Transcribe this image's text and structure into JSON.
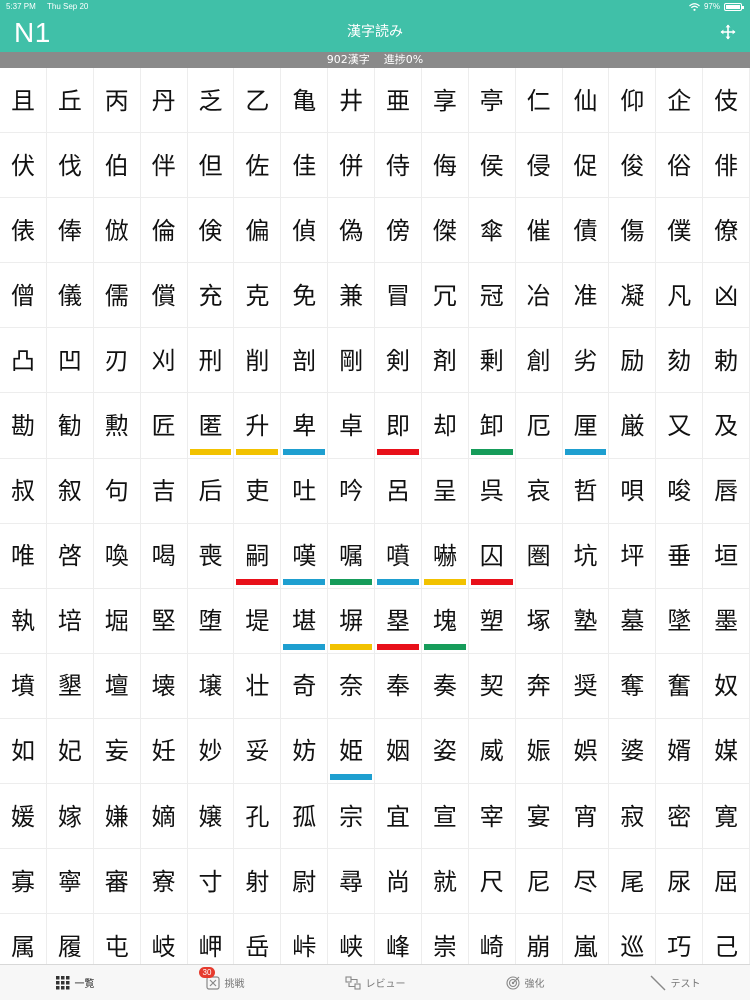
{
  "status_bar": {
    "time": "5:37 PM",
    "date": "Thu Sep 20",
    "battery": "97%",
    "battery_level": 0.97,
    "icons": [
      "wifi-icon",
      "battery-icon"
    ]
  },
  "header": {
    "level": "N1",
    "title": "漢字読み",
    "action_icon": "move-arrows-icon"
  },
  "progress": {
    "count_label": "902漢字",
    "progress_label": "進捗0%"
  },
  "colors": {
    "accent": "#40c0a8",
    "progress_bg": "#8a8a8a",
    "mark_yellow": "#f2c200",
    "mark_blue": "#1e9fd0",
    "mark_red": "#e8101a",
    "mark_green": "#169c5a",
    "badge_red": "#e63b2e"
  },
  "kanji_rows": [
    [
      "且",
      "丘",
      "丙",
      "丹",
      "乏",
      "乙",
      "亀",
      "井",
      "亜",
      "享",
      "亭",
      "仁",
      "仙",
      "仰",
      "企",
      "伎"
    ],
    [
      "伏",
      "伐",
      "伯",
      "伴",
      "但",
      "佐",
      "佳",
      "併",
      "侍",
      "侮",
      "侯",
      "侵",
      "促",
      "俊",
      "俗",
      "俳"
    ],
    [
      "俵",
      "俸",
      "倣",
      "倫",
      "倹",
      "偏",
      "偵",
      "偽",
      "傍",
      "傑",
      "傘",
      "催",
      "債",
      "傷",
      "僕",
      "僚"
    ],
    [
      "僧",
      "儀",
      "儒",
      "償",
      "充",
      "克",
      "免",
      "兼",
      "冒",
      "冗",
      "冠",
      "冶",
      "准",
      "凝",
      "凡",
      "凶"
    ],
    [
      "凸",
      "凹",
      "刃",
      "刈",
      "刑",
      "削",
      "剖",
      "剛",
      "剣",
      "剤",
      "剰",
      "創",
      "劣",
      "励",
      "劾",
      "勅"
    ],
    [
      "勘",
      "勧",
      "勲",
      "匠",
      "匿",
      "升",
      "卑",
      "卓",
      "即",
      "却",
      "卸",
      "厄",
      "厘",
      "厳",
      "又",
      "及"
    ],
    [
      "叔",
      "叙",
      "句",
      "吉",
      "后",
      "吏",
      "吐",
      "吟",
      "呂",
      "呈",
      "呉",
      "哀",
      "哲",
      "唄",
      "唆",
      "唇"
    ],
    [
      "唯",
      "啓",
      "喚",
      "喝",
      "喪",
      "嗣",
      "嘆",
      "嘱",
      "噴",
      "嚇",
      "囚",
      "圏",
      "坑",
      "坪",
      "垂",
      "垣"
    ],
    [
      "執",
      "培",
      "堀",
      "堅",
      "堕",
      "堤",
      "堪",
      "塀",
      "塁",
      "塊",
      "塑",
      "塚",
      "塾",
      "墓",
      "墜",
      "墨"
    ],
    [
      "墳",
      "墾",
      "壇",
      "壊",
      "壌",
      "壮",
      "奇",
      "奈",
      "奉",
      "奏",
      "契",
      "奔",
      "奨",
      "奪",
      "奮",
      "奴"
    ],
    [
      "如",
      "妃",
      "妄",
      "妊",
      "妙",
      "妥",
      "妨",
      "姫",
      "姻",
      "姿",
      "威",
      "娠",
      "娯",
      "婆",
      "婿",
      "媒"
    ],
    [
      "媛",
      "嫁",
      "嫌",
      "嫡",
      "嬢",
      "孔",
      "孤",
      "宗",
      "宜",
      "宣",
      "宰",
      "宴",
      "宵",
      "寂",
      "密",
      "寛"
    ],
    [
      "寡",
      "寧",
      "審",
      "寮",
      "寸",
      "射",
      "尉",
      "尋",
      "尚",
      "就",
      "尺",
      "尼",
      "尽",
      "尾",
      "尿",
      "屈"
    ],
    [
      "属",
      "履",
      "屯",
      "岐",
      "岬",
      "岳",
      "峠",
      "峡",
      "峰",
      "崇",
      "崎",
      "崩",
      "嵐",
      "巡",
      "巧",
      "己"
    ]
  ],
  "marks": [
    {
      "row": 5,
      "col": 4,
      "color": "yellow"
    },
    {
      "row": 5,
      "col": 5,
      "color": "yellow"
    },
    {
      "row": 5,
      "col": 6,
      "color": "blue"
    },
    {
      "row": 5,
      "col": 8,
      "color": "red"
    },
    {
      "row": 5,
      "col": 10,
      "color": "green"
    },
    {
      "row": 5,
      "col": 12,
      "color": "blue"
    },
    {
      "row": 7,
      "col": 5,
      "color": "red"
    },
    {
      "row": 7,
      "col": 6,
      "color": "blue"
    },
    {
      "row": 7,
      "col": 7,
      "color": "green"
    },
    {
      "row": 7,
      "col": 8,
      "color": "blue"
    },
    {
      "row": 7,
      "col": 9,
      "color": "yellow"
    },
    {
      "row": 7,
      "col": 10,
      "color": "red"
    },
    {
      "row": 8,
      "col": 6,
      "color": "blue"
    },
    {
      "row": 8,
      "col": 7,
      "color": "yellow"
    },
    {
      "row": 8,
      "col": 8,
      "color": "red"
    },
    {
      "row": 8,
      "col": 9,
      "color": "green"
    },
    {
      "row": 10,
      "col": 7,
      "color": "blue"
    }
  ],
  "tabs": [
    {
      "label": "一覧",
      "icon": "grid-icon",
      "active": true
    },
    {
      "label": "挑戦",
      "icon": "challenge-icon",
      "badge": "30",
      "active": false
    },
    {
      "label": "レビュー",
      "icon": "review-icon",
      "active": false
    },
    {
      "label": "強化",
      "icon": "target-icon",
      "active": false
    },
    {
      "label": "テスト",
      "icon": "pencil-icon",
      "active": false
    }
  ]
}
